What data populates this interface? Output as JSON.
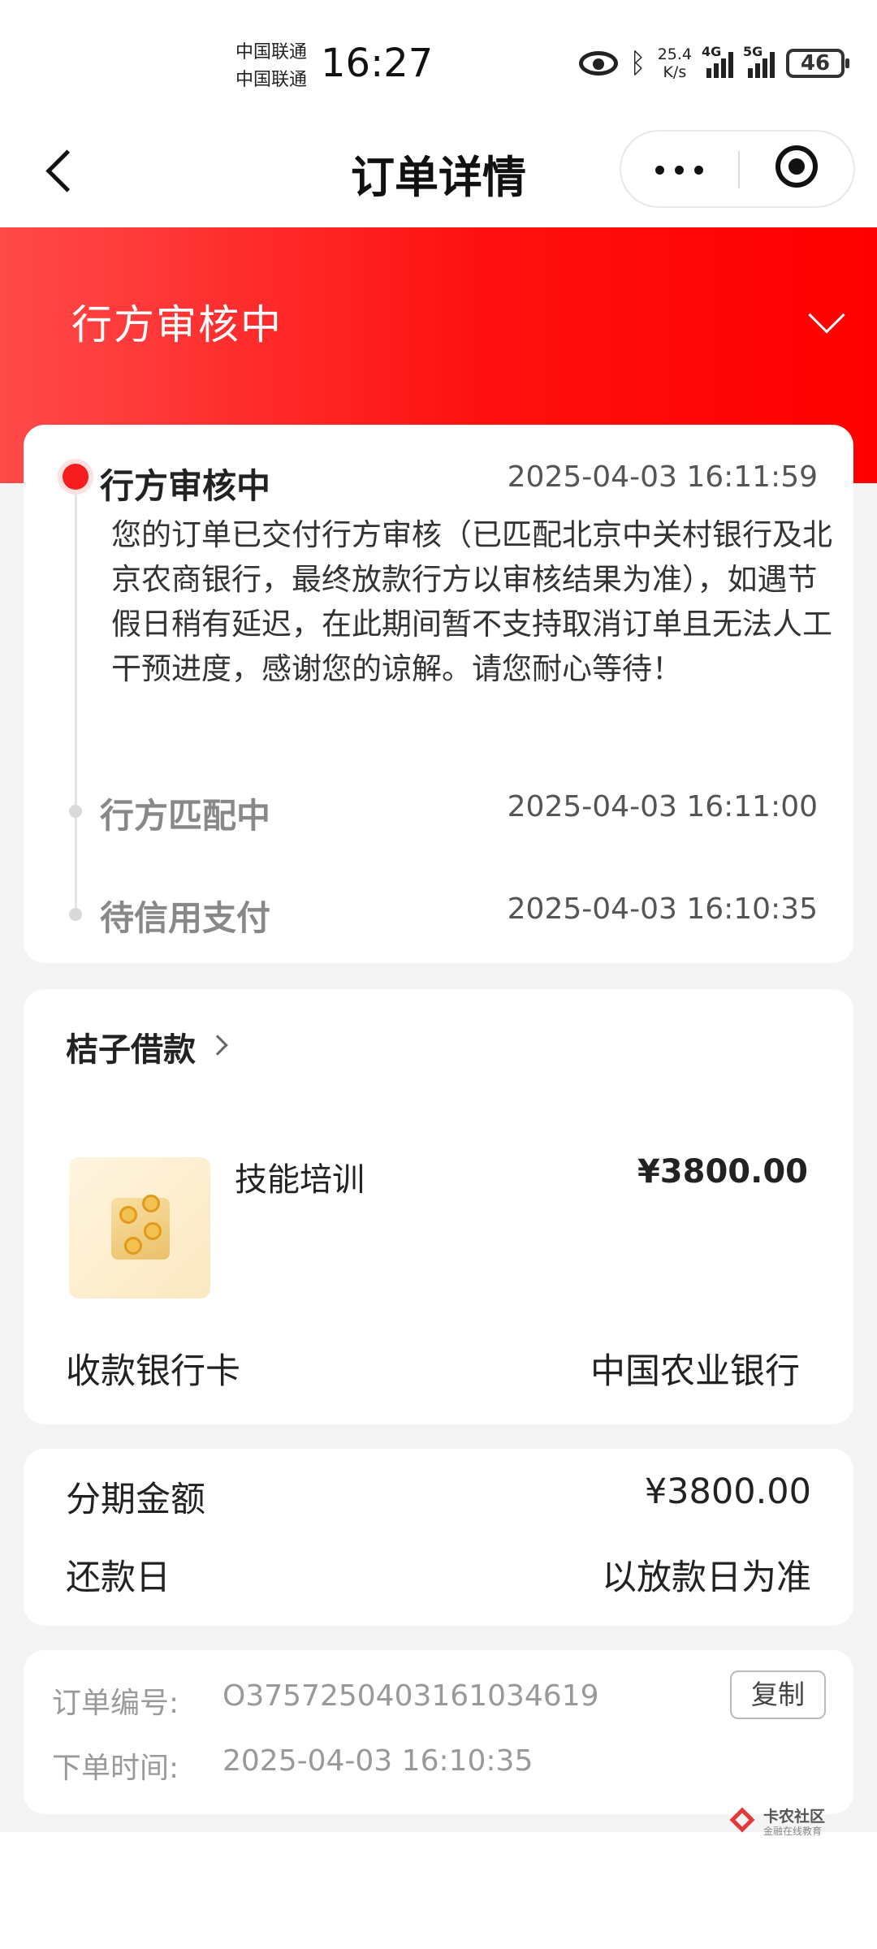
{
  "status_bar": {
    "carrier_1": "中国联通",
    "carrier_2": "中国联通",
    "time": "16:27",
    "speed_value": "25.4",
    "speed_unit": "K/s",
    "signal_1_tag": "4G",
    "signal_2_tag": "5G",
    "battery": "46"
  },
  "nav": {
    "title": "订单详情",
    "back_icon": "chevron-left-icon",
    "more_icon": "more-dots-icon",
    "close_icon": "target-icon"
  },
  "header": {
    "status_title": "行方审核中",
    "expand_icon": "chevron-down-icon",
    "background_color": "#ff1a1a"
  },
  "timeline": [
    {
      "title": "行方审核中",
      "time": "2025-04-03 16:11:59",
      "active": true,
      "description": "您的订单已交付行方审核（已匹配北京中关村银行及北京农商银行，最终放款行方以审核结果为准），如遇节假日稍有延迟，在此期间暂不支持取消订单且无法人工干预进度，感谢您的谅解。请您耐心等待！"
    },
    {
      "title": "行方匹配中",
      "time": "2025-04-03 16:11:00",
      "active": false
    },
    {
      "title": "待信用支付",
      "time": "2025-04-03 16:10:35",
      "active": false
    }
  ],
  "product": {
    "merchant": "桔子借款",
    "name": "技能培训",
    "price": "¥3800.00",
    "bank_label": "收款银行卡",
    "bank_value": "中国农业银行"
  },
  "loan": {
    "amount_label": "分期金额",
    "amount_value": "¥3800.00",
    "repay_label": "还款日",
    "repay_value": "以放款日为准"
  },
  "order": {
    "number_label": "订单编号:",
    "number_value": "O3757250403161034619",
    "copy_label": "复制",
    "time_label": "下单时间:",
    "time_value": "2025-04-03 16:10:35"
  },
  "watermark": {
    "title": "卡农社区",
    "subtitle": "金融在线教育"
  }
}
